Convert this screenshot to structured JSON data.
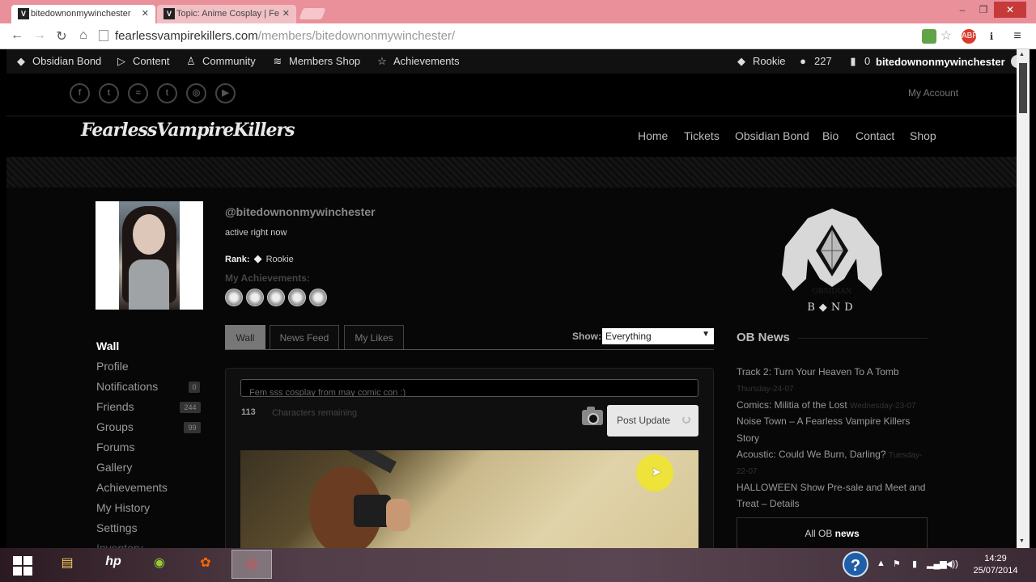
{
  "browser": {
    "tabs": [
      {
        "title": "bitedownonmywinchester"
      },
      {
        "title": "Topic: Anime Cosplay | Fe"
      }
    ],
    "close_glyph": "✕",
    "window_controls": {
      "minimize": "–",
      "restore": "❐",
      "close": "✕"
    },
    "nav": {
      "back": "←",
      "forward": "→",
      "reload": "↻",
      "home": "⌂"
    },
    "url_host": "fearlessvampirekillers.com",
    "url_path": "/members/bitedownonmywinchester/",
    "extensions": {
      "star": "☆",
      "menu": "≡"
    }
  },
  "adminbar": {
    "items": [
      {
        "label": "Obsidian Bond",
        "icon": "diamond-icon",
        "glyph": "◆"
      },
      {
        "label": "Content",
        "icon": "play-icon",
        "glyph": "▷"
      },
      {
        "label": "Community",
        "icon": "person-icon",
        "glyph": "♙"
      },
      {
        "label": "Members Shop",
        "icon": "shop-icon",
        "glyph": "≋"
      },
      {
        "label": "Achievements",
        "icon": "star-icon",
        "glyph": "☆"
      }
    ],
    "rank": {
      "label": "Rookie",
      "glyph": "◆"
    },
    "points": {
      "value": "227",
      "glyph": "●"
    },
    "notifications": {
      "value": "0",
      "glyph": "▮"
    },
    "username": "bitedownonmywinchester"
  },
  "header": {
    "social": [
      {
        "name": "facebook-icon",
        "glyph": "f"
      },
      {
        "name": "twitter-icon",
        "glyph": "t"
      },
      {
        "name": "spotify-icon",
        "glyph": "≈"
      },
      {
        "name": "tumblr-icon",
        "glyph": "t"
      },
      {
        "name": "instagram-icon",
        "glyph": "◎"
      },
      {
        "name": "youtube-icon",
        "glyph": "▶"
      }
    ],
    "my_account": "My Account",
    "logo_text": "FearlessVampireKillers",
    "nav": [
      "Home",
      "Tickets",
      "Obsidian Bond",
      "Bio",
      "Contact",
      "Shop"
    ]
  },
  "profile": {
    "handle": "@bitedownonmywinchester",
    "status": "active right now",
    "rank_label": "Rank:",
    "rank_glyph": "◆",
    "rank_value": "Rookie",
    "achievements_label": "My Achievements:",
    "achievement_count": 5
  },
  "sidebar": [
    {
      "label": "Wall",
      "active": true
    },
    {
      "label": "Profile"
    },
    {
      "label": "Notifications",
      "count": "0"
    },
    {
      "label": "Friends",
      "count": "244"
    },
    {
      "label": "Groups",
      "count": "99"
    },
    {
      "label": "Forums"
    },
    {
      "label": "Gallery"
    },
    {
      "label": "Achievements"
    },
    {
      "label": "My History"
    },
    {
      "label": "Settings"
    },
    {
      "label": "Inventory"
    }
  ],
  "wall": {
    "tabs": [
      "Wall",
      "News Feed",
      "My Likes"
    ],
    "show_label": "Show:",
    "show_value": "Everything",
    "select_arrow": "▼",
    "textarea_text": "Fem sss cosplay from may comic con :)",
    "chars_count": "113",
    "chars_label": "Characters remaining",
    "post_button": "Post Update"
  },
  "ob": {
    "logo_top": "OBSIDIAN",
    "logo_bottom": "B◆ND",
    "title": "OB News",
    "news": [
      {
        "title": "Track 2: Turn Your Heaven To A Tomb",
        "date": "Thursday-24-07"
      },
      {
        "title": "Comics: Militia of the Lost",
        "date": "Wednesday-23-07"
      },
      {
        "title": "Noise Town – A Fearless Vampire Killers",
        "date": ""
      },
      {
        "title": "Story",
        "date": ""
      },
      {
        "title": "Acoustic: Could We Burn, Darling?",
        "date": "Tuesday-"
      },
      {
        "title": "22-07",
        "date": ""
      },
      {
        "title": "HALLOWEEN Show Pre-sale and Meet and",
        "date": ""
      },
      {
        "title": "Treat – Details",
        "date": ""
      }
    ],
    "all_prefix": "All OB",
    "all_suffix": "news"
  },
  "scroll": {
    "up": "▲",
    "down": "▼"
  },
  "taskbar": {
    "apps": [
      {
        "name": "file-explorer-icon",
        "glyph": "▤"
      },
      {
        "name": "hp-icon",
        "glyph": "hp"
      },
      {
        "name": "webcam-icon",
        "glyph": "◉"
      },
      {
        "name": "paint-icon",
        "glyph": "✿"
      },
      {
        "name": "chrome-icon",
        "glyph": "◎"
      }
    ],
    "help_glyph": "?",
    "tray": [
      "▲",
      "⚑",
      "▮",
      "▂▄▆",
      "◀))"
    ],
    "time": "14:29",
    "date": "25/07/2014"
  }
}
